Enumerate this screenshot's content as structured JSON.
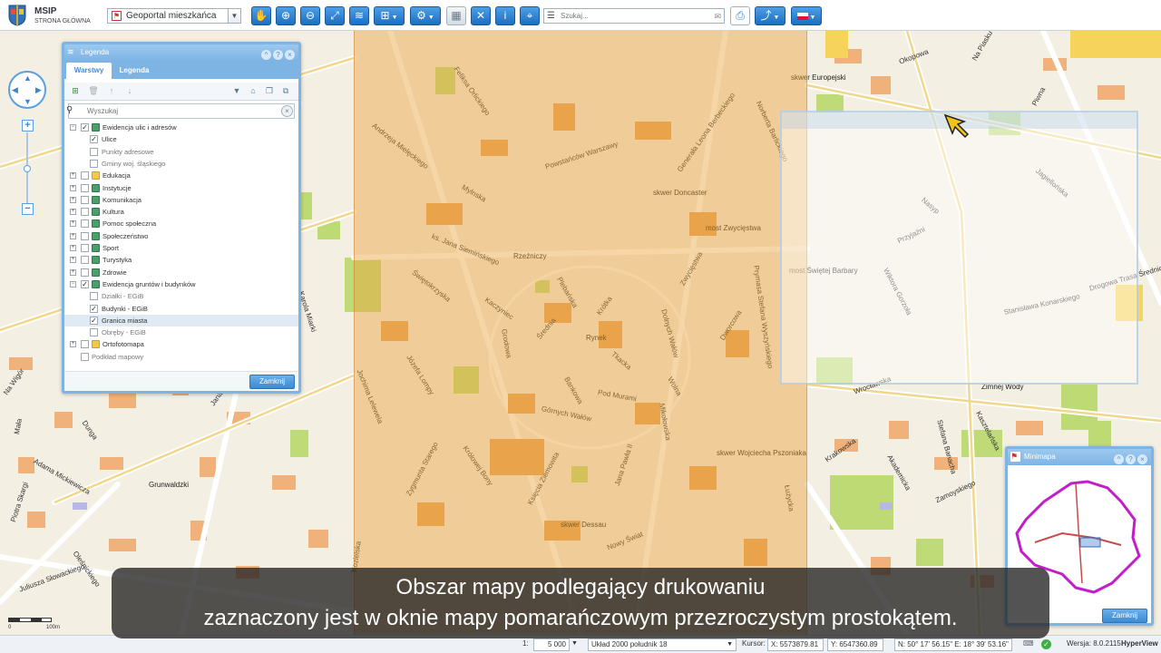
{
  "app": {
    "brand_title": "MSIP",
    "brand_subtitle": "STRONA GŁÓWNA",
    "portal_select": "Geoportal mieszkańca",
    "search_placeholder": "Szukaj...",
    "colors": {
      "accent": "#2a7fd4",
      "panel_border": "#7eb4e4",
      "print_area": "#eca53c"
    }
  },
  "toolbar": {
    "icons": [
      "hand-pan-icon",
      "zoom-in-icon",
      "zoom-out-icon",
      "full-extent-icon",
      "layers-icon",
      "add-layer-icon",
      "tools-icon",
      "table-icon",
      "measure-icon",
      "info-icon",
      "sketch-icon",
      "list-icon",
      "print-icon",
      "share-icon",
      "flag-pl-icon"
    ]
  },
  "legend": {
    "title": "Legenda",
    "tabs": [
      {
        "label": "Warstwy",
        "active": true
      },
      {
        "label": "Legenda",
        "active": false
      }
    ],
    "search_placeholder": "Wyszukaj",
    "close_label": "Zamknij",
    "tree": [
      {
        "label": "Ewidencja ulic i adresów",
        "level": 0,
        "expanded": true,
        "checked": true,
        "icon": "layer"
      },
      {
        "label": "Ulice",
        "level": 1,
        "checked": true
      },
      {
        "label": "Punkty adresowe",
        "level": 1,
        "checked": false,
        "muted": true
      },
      {
        "label": "Gminy woj. śląskiego",
        "level": 1,
        "checked": false,
        "muted": true
      },
      {
        "label": "Edukacja",
        "level": 0,
        "expanded": false,
        "checked": false,
        "icon": "folder"
      },
      {
        "label": "Instytucje",
        "level": 0,
        "expanded": false,
        "checked": false,
        "icon": "layer"
      },
      {
        "label": "Komunikacja",
        "level": 0,
        "expanded": false,
        "checked": false,
        "icon": "layer"
      },
      {
        "label": "Kultura",
        "level": 0,
        "expanded": false,
        "checked": false,
        "icon": "layer"
      },
      {
        "label": "Pomoc społeczna",
        "level": 0,
        "expanded": false,
        "checked": false,
        "icon": "layer"
      },
      {
        "label": "Społeczeństwo",
        "level": 0,
        "expanded": false,
        "checked": false,
        "icon": "layer"
      },
      {
        "label": "Sport",
        "level": 0,
        "expanded": false,
        "checked": false,
        "icon": "layer"
      },
      {
        "label": "Turystyka",
        "level": 0,
        "expanded": false,
        "checked": false,
        "icon": "layer"
      },
      {
        "label": "Zdrowie",
        "level": 0,
        "expanded": false,
        "checked": false,
        "icon": "layer"
      },
      {
        "label": "Ewidencja gruntów i budynków",
        "level": 0,
        "expanded": true,
        "checked": true,
        "icon": "layer"
      },
      {
        "label": "Działki - EGiB",
        "level": 1,
        "checked": false,
        "muted": true
      },
      {
        "label": "Budynki - EGiB",
        "level": 1,
        "checked": true
      },
      {
        "label": "Granica miasta",
        "level": 1,
        "checked": true,
        "selected": true
      },
      {
        "label": "Obręby - EGiB",
        "level": 1,
        "checked": false,
        "muted": true
      },
      {
        "label": "Ortofotomapa",
        "level": 0,
        "expanded": false,
        "checked": false,
        "icon": "folder"
      },
      {
        "label": "Podkład mapowy",
        "level": 0,
        "checked": false,
        "muted": true,
        "leaf": true
      }
    ]
  },
  "map": {
    "places": [
      "Rynek",
      "Rzeźniczy",
      "skwer Europejski",
      "skwer Doncaster",
      "most Zwycięstwa",
      "most Świętej Barbary",
      "skwer Wojciecha Pszoniaka",
      "skwer Dessau",
      "Grunwaldzki",
      "Zimnej Wody"
    ],
    "streets": [
      "Feliksa Orlickiego",
      "Andrzeja Mielęckiego",
      "Mylnska",
      "Powstańców Warszawy",
      "Generała Leona Berbeckiego",
      "Norberta Barlickiego",
      "ks. Jana Siemińskiego",
      "Świętokrzyska",
      "Kaczyniec",
      "Plebańska",
      "Krótka",
      "Dolnych Wałów",
      "Zwycięstwa",
      "Prymasa Stefana Wyszyńskiego",
      "Grodowa",
      "Średnia",
      "Bankowa",
      "Tkacka",
      "Wolna",
      "Pod Murami",
      "Górnych Wałów",
      "Józefa Lompy",
      "Mikołowska",
      "Dworcowa",
      "Jochima Lelewela",
      "Zygmunta Starego",
      "Królowej Bony",
      "Księcia Ziemowita",
      "Jana Pawła II",
      "Kozielska",
      "Karola Miarki",
      "Dunga",
      "Jana Długosza",
      "Adama Mickiewicza",
      "Mała",
      "Piotra Skargi",
      "Oleśnickiego",
      "Juliusza Słowackiego",
      "Nowy Świat",
      "Okopowa",
      "Na Piasku",
      "Piwna",
      "Jagiellońska",
      "Przyjaźni",
      "Wiktora Gorzoła",
      "Stanisława Konarskiego",
      "Wrocławska",
      "Kasztelańska",
      "Krakowska",
      "Akademicka",
      "Stefana Banacha",
      "Łużycka",
      "Zamoyskiego",
      "Nasyp",
      "Na Wigór",
      "Drogowa Trasa Średnicowa"
    ],
    "scale_labels": [
      "0",
      "100m"
    ]
  },
  "minimap": {
    "title": "Minimapa",
    "close_label": "Zamknij"
  },
  "status": {
    "scale_label": "1:",
    "scale_value": "5 000",
    "crs": "Układ 2000 południk 18",
    "cursor_label": "Kursor:",
    "x_value": "X: 5573879.81",
    "y_value": "Y: 6547360.89",
    "geo_value": "N: 50° 17' 56.15\" E: 18° 39' 53.16\"",
    "version": "Wersja: 8.0.2115",
    "vendor": "HyperView"
  },
  "subtitle": {
    "line1": "Obszar mapy podlegający drukowaniu",
    "line2": "zaznaczony jest w oknie mapy pomarańczowym przezroczystym prostokątem."
  }
}
